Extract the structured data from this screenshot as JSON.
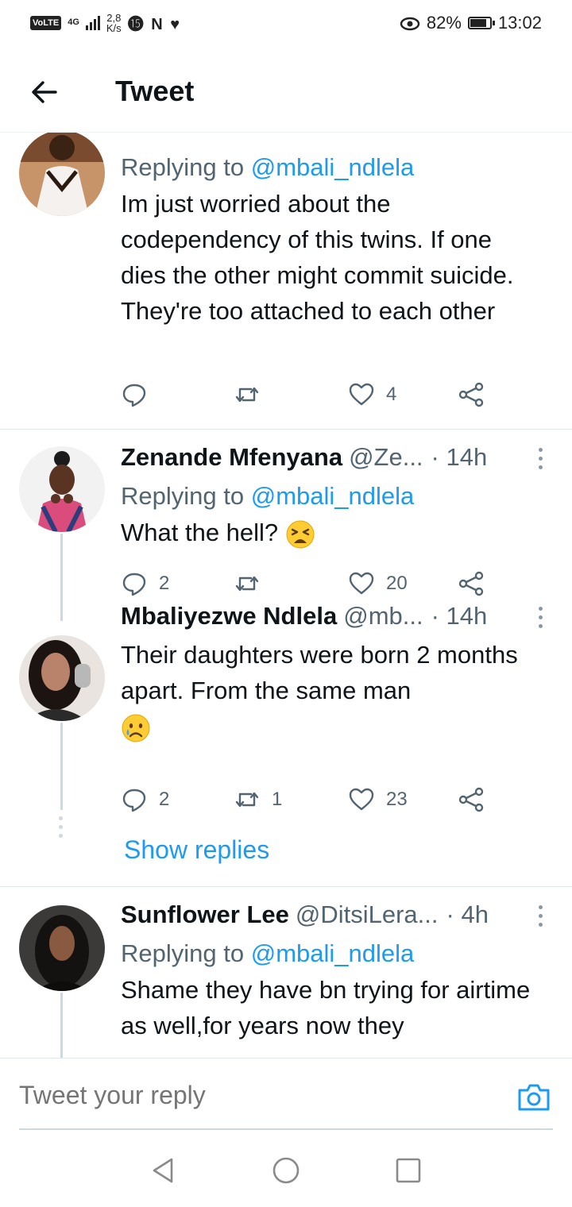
{
  "status_bar": {
    "volte": "VoLTE",
    "network": "4G",
    "speed_value": "2,8",
    "speed_unit": "K/s",
    "notification_icons": "⓯ N ♥",
    "battery_percent": "82%",
    "battery_level": 0.82,
    "time": "13:02"
  },
  "header": {
    "title": "Tweet"
  },
  "tweets": [
    {
      "replying_label": "Replying to",
      "replying_handle": "@mbali_ndlela",
      "body": "Im just worried about the codependency of this twins. If one dies the other might commit suicide. They're too attached to each other",
      "replies": "",
      "retweets": "",
      "likes": "4"
    },
    {
      "name": "Zenande Mfenyana",
      "handle": "@Ze...",
      "time": "· 14h",
      "replying_label": "Replying to",
      "replying_handle": "@mbali_ndlela",
      "body": "What the hell?",
      "emoji": "tired-face",
      "replies": "2",
      "retweets": "",
      "likes": "20"
    },
    {
      "name": "Mbaliyezwe Ndlela",
      "handle": "@mb...",
      "time": "· 14h",
      "body": "Their daughters were born 2 months apart. From the same man",
      "emoji": "crying-face",
      "replies": "2",
      "retweets": "1",
      "likes": "23",
      "show_replies": "Show replies"
    },
    {
      "name": "Sunflower Lee",
      "handle": "@DitsiLera...",
      "time": "· 4h",
      "replying_label": "Replying to",
      "replying_handle": "@mbali_ndlela",
      "body": "Shame they have bn trying for airtime as well,for years now they"
    }
  ],
  "reply_bar": {
    "placeholder": "Tweet your reply"
  },
  "colors": {
    "accent": "#1d9bf0",
    "text": "#0f1419",
    "muted": "#536471"
  }
}
